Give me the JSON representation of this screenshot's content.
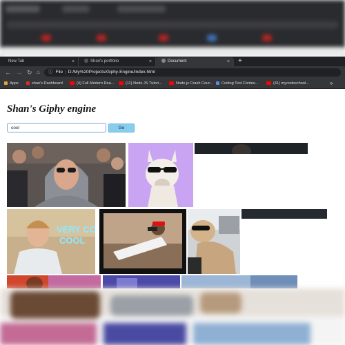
{
  "browser": {
    "tabs": [
      {
        "label": "New Tab",
        "active": false
      },
      {
        "label": "Shan's portfolio",
        "active": false
      },
      {
        "label": "Document",
        "active": true
      }
    ],
    "new_tab_symbol": "+",
    "close_symbol": "×",
    "address": {
      "scheme_label": "File",
      "url": "D:/My%20Projects/Giphy-Engine/index.html"
    },
    "bookmarks": [
      {
        "label": "Apps",
        "icon": "apps-grid-icon",
        "color": "#e8a33d"
      },
      {
        "label": "shan's Dashboard",
        "icon": "c-logo-icon",
        "color": "#d93025"
      },
      {
        "label": "(4) Full Modern Rea...",
        "icon": "youtube-icon",
        "color": "#ff0000"
      },
      {
        "label": "(11) Node JS Tutori...",
        "icon": "youtube-icon",
        "color": "#ff0000"
      },
      {
        "label": "Node.js Crash Cour...",
        "icon": "youtube-icon",
        "color": "#ff0000"
      },
      {
        "label": "Coding Test Contes...",
        "icon": "contest-icon",
        "color": "#5b8dd8"
      },
      {
        "label": "(41) mycodeschool...",
        "icon": "youtube-icon",
        "color": "#ff0000"
      }
    ],
    "overflow_symbol": "»"
  },
  "page": {
    "title": "Shan's Giphy engine",
    "search": {
      "value": "cool",
      "placeholder": ""
    },
    "go_label": "Go",
    "gifs": [
      {
        "name": "woman-sunglasses-hoodie-gif"
      },
      {
        "name": "llama-sunglasses-gif"
      },
      {
        "name": "man-dark-gif-loading"
      },
      {
        "name": "very-cool-boy-gif",
        "caption": "VERY COOL"
      },
      {
        "name": "man-red-cap-lying-gif"
      },
      {
        "name": "dog-sunglasses-car-gif"
      },
      {
        "name": "dark-gif-loading-2"
      },
      {
        "name": "partial-gif-1"
      },
      {
        "name": "partial-gif-2"
      },
      {
        "name": "partial-gif-3"
      }
    ]
  }
}
